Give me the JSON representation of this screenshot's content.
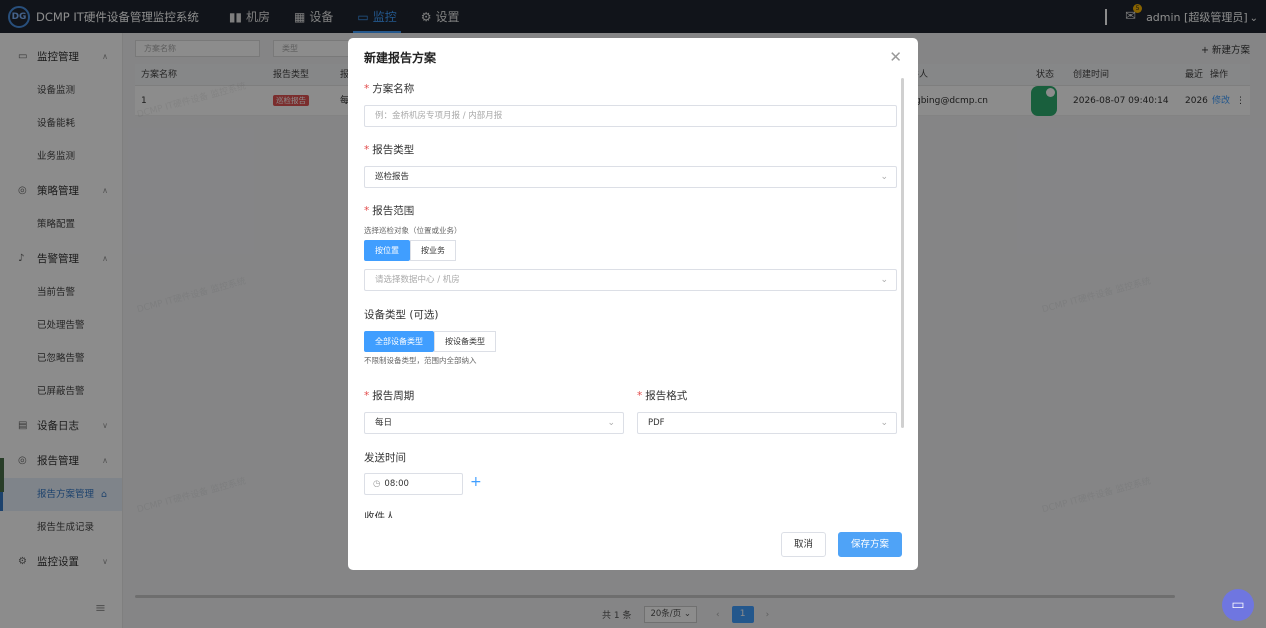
{
  "header": {
    "logo_mark": "DG",
    "app_title": "DCMP IT硬件设备管理监控系统",
    "nav": [
      {
        "label": "机房",
        "icon": "bar-chart-icon"
      },
      {
        "label": "设备",
        "icon": "grid-icon"
      },
      {
        "label": "监控",
        "icon": "monitor-icon",
        "active": true
      },
      {
        "label": "设置",
        "icon": "gear-icon"
      }
    ],
    "mail_badge": "5",
    "user_label": "admin [超级管理员]"
  },
  "sidebar": {
    "groups": [
      {
        "label": "监控管理",
        "icon": "monitor-icon",
        "items": [
          "设备监测",
          "设备能耗",
          "业务监测"
        ]
      },
      {
        "label": "策略管理",
        "icon": "bulb-icon",
        "items": [
          "策略配置"
        ]
      },
      {
        "label": "告警管理",
        "icon": "bell-icon",
        "items": [
          "当前告警",
          "已处理告警",
          "已忽略告警",
          "已屏蔽告警"
        ]
      },
      {
        "label": "设备日志",
        "icon": "document-icon",
        "items": []
      },
      {
        "label": "报告管理",
        "icon": "bulb-icon",
        "items": [
          "报告方案管理",
          "报告生成记录"
        ]
      },
      {
        "label": "监控设置",
        "icon": "gear-icon",
        "items": []
      }
    ],
    "active_item": "报告方案管理"
  },
  "main": {
    "filter_placeholders": [
      "方案名称",
      "类型"
    ],
    "new_button": "+ 新建方案",
    "columns": [
      "方案名称",
      "报告类型",
      "报",
      "件人",
      "状态",
      "创建时间",
      "最近",
      "操作"
    ],
    "row": {
      "name": "1",
      "type_tag": "巡检报告",
      "period": "每",
      "recipient": "gbing@dcmp.cn",
      "created": "2026-08-07 09:40:14",
      "recent": "2026",
      "edit": "修改",
      "more": "⋮"
    },
    "pager": {
      "total": "共 1 条",
      "page_size": "20条/页",
      "current": "1"
    },
    "watermark": "DCMP IT硬件设备 监控系统"
  },
  "modal": {
    "title": "新建报告方案",
    "name_label": "方案名称",
    "name_placeholder": "例：金桥机房专项月报 / 内部月报",
    "type_label": "报告类型",
    "type_value": "巡检报告",
    "scope_label": "报告范围",
    "scope_hint": "选择巡检对象（位置或业务）",
    "scope_options": [
      "按位置",
      "按业务"
    ],
    "scope_placeholder": "请选择数据中心 / 机房",
    "device_type_label": "设备类型 (可选)",
    "device_type_options": [
      "全部设备类型",
      "按设备类型"
    ],
    "device_type_hint": "不限制设备类型，范围内全部纳入",
    "period_label": "报告周期",
    "period_value": "每日",
    "format_label": "报告格式",
    "format_value": "PDF",
    "send_time_label": "发送时间",
    "send_time_value": "08:00",
    "recipients_label": "收件人",
    "cancel": "取消",
    "save": "保存方案"
  }
}
